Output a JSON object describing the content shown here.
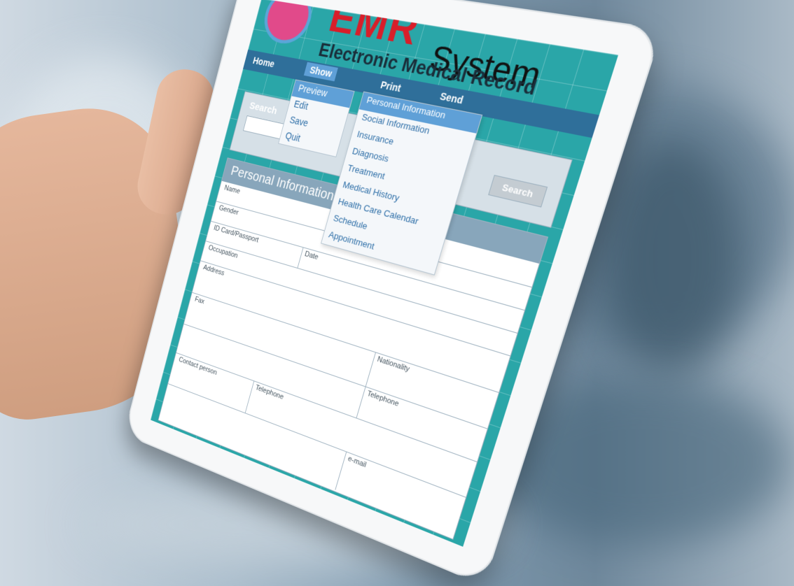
{
  "header": {
    "app_title": "EMR",
    "app_title_2": "System",
    "subtitle": "Electronic Medical Record"
  },
  "nav": {
    "items": [
      "Home",
      "Show",
      "Print",
      "Send"
    ]
  },
  "show_menu": {
    "items": [
      "Preview",
      "Edit",
      "Save",
      "Quit"
    ],
    "active": "Preview"
  },
  "submenu": {
    "items": [
      "Personal Information",
      "Social Information",
      "Insurance",
      "Diagnosis",
      "Treatment",
      "Medical History",
      "Health Care Calendar",
      "Schedule",
      "Appointment"
    ],
    "active": "Personal Information"
  },
  "search": {
    "label": "Search",
    "button": "Search"
  },
  "form": {
    "title": "Personal Information",
    "fields": {
      "name": "Name",
      "gender": "Gender",
      "id": "ID Card/Passport",
      "date": "Date",
      "occupation": "Occupation",
      "address": "Address",
      "fax": "Fax",
      "nationality": "Nationality",
      "contact": "Contact person",
      "telephone": "Telephone",
      "telephone2": "Telephone",
      "email": "e-mail"
    }
  },
  "colors": {
    "screen": "#2aa6a8",
    "nav": "#2f6f9a",
    "title_red": "#d81e2a",
    "menu_active": "#5fa0d7"
  }
}
